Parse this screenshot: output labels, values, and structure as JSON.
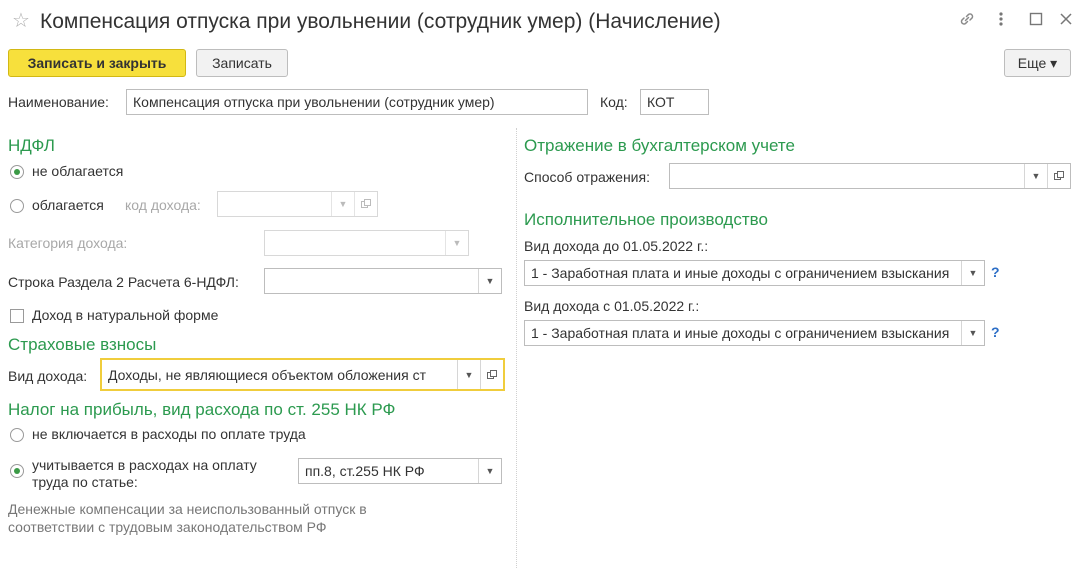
{
  "window": {
    "title": "Компенсация отпуска при увольнении (сотрудник умер) (Начисление)",
    "icons": {
      "favorite": "star-icon",
      "link": "link-icon",
      "more": "vertical-dots-icon",
      "maximize": "maximize-icon",
      "close": "close-icon"
    }
  },
  "toolbar": {
    "save_close_label": "Записать и закрыть",
    "save_label": "Записать",
    "more_label": "Еще ▾"
  },
  "header": {
    "name_label": "Наименование:",
    "name_value": "Компенсация отпуска при увольнении (сотрудник умер)",
    "code_label": "Код:",
    "code_value": "КОТ"
  },
  "ndfl": {
    "section_title": "НДФЛ",
    "not_taxed_label": "не облагается",
    "taxed_label": "облагается",
    "income_code_label": "код дохода:",
    "income_code_value": "",
    "income_category_label": "Категория дохода:",
    "income_category_value": "",
    "row_6ndfl_label": "Строка Раздела 2 Расчета 6-НДФЛ:",
    "row_6ndfl_value": "",
    "in_kind_label": "Доход в натуральной форме",
    "selected": "not_taxed",
    "in_kind_checked": false
  },
  "insurance": {
    "section_title": "Страховые взносы",
    "income_type_label": "Вид дохода:",
    "income_type_value": "Доходы, не являющиеся объектом обложения ст"
  },
  "profit_tax": {
    "section_title": "Налог на прибыль, вид расхода по ст. 255 НК РФ",
    "not_included_label": "не включается в расходы по оплате труда",
    "included_label_line1": "учитывается в расходах на оплату",
    "included_label_line2": "труда по статье:",
    "article_value": "пп.8, ст.255 НК РФ",
    "selected": "included",
    "note_line1": "Денежные компенсации за неиспользованный отпуск в",
    "note_line2": "соответствии с трудовым законодательством РФ"
  },
  "accounting": {
    "section_title": "Отражение в бухгалтерском учете",
    "method_label": "Способ отражения:",
    "method_value": ""
  },
  "enforcement": {
    "section_title": "Исполнительное производство",
    "before_label": "Вид дохода до 01.05.2022 г.:",
    "before_value": "1 - Заработная плата и иные доходы с ограничением взыскания",
    "after_label": "Вид дохода с 01.05.2022 г.:",
    "after_value": "1 - Заработная плата и иные доходы с ограничением взыскания",
    "help_label": "?"
  }
}
